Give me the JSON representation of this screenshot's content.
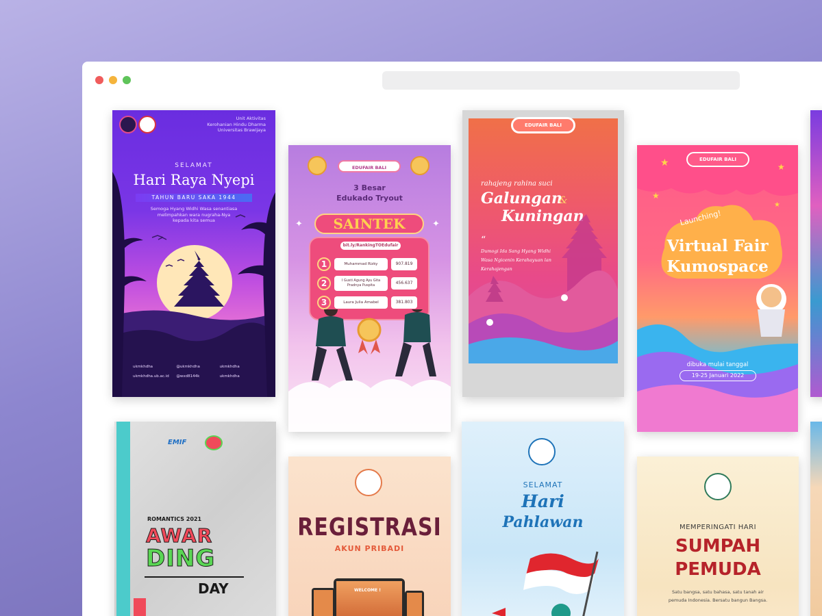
{
  "window": {
    "address_bar_value": ""
  },
  "cards": {
    "nyepi": {
      "org": [
        "Unit Aktivitas",
        "Kerohanian Hindu Dharma",
        "Universitas Brawijaya"
      ],
      "selamat": "SELAMAT",
      "title": "Hari Raya Nyepi",
      "ribbon": "TAHUN BARU SAKA 1944",
      "message": [
        "Semoga Hyang Widhi Wasa senantiasa",
        "melimpahkan wara nugraha-Nya",
        "kepada kita semua"
      ],
      "socials": [
        "ukmkhdha",
        "@ukmkhdha",
        "ukmkhdha",
        "ukmkhdha.ub.ac.id",
        "@wxd8144k",
        "ukmkhdha"
      ]
    },
    "saintek": {
      "badge": "EDUFAIR BALI",
      "subtitle_line1": "3 Besar",
      "subtitle_line2": "Edukado Tryout",
      "title": "SAINTEK",
      "link": "bit.ly/RankingTOEdufair",
      "rankings": [
        {
          "rank": "1",
          "name": "Muhammad Rizky",
          "score": "907.819"
        },
        {
          "rank": "2",
          "name": "I Gusti Agung Ayu Gita Pradnya Puspita",
          "score": "456.637"
        },
        {
          "rank": "3",
          "name": "Laura Julia Amabel",
          "score": "381.803"
        }
      ]
    },
    "galungan": {
      "badge": "EDUFAIR BALI",
      "greeting": "rahajeng rahina suci",
      "title_line1": "Galungan",
      "title_amp": "&",
      "title_line2": "Kuningan",
      "quote_mark": "“",
      "quote": [
        "Dumogi Ida Sang Hyang Widhi",
        "Wasa Ngicenin Kerahayuan lan",
        "Kerahajengan"
      ]
    },
    "kumospace": {
      "badge": "EDUFAIR BALI",
      "launching": "Launching!",
      "title_line1": "Virtual Fair",
      "title_line2": "Kumospace",
      "open_text": "dibuka mulai tanggal",
      "dates": "19-25 Januari 2022"
    },
    "awarding": {
      "logo": "EMIF",
      "year": "ROMANTICS 2021",
      "line1": "AWAR",
      "line2": "DING",
      "line3": "DAY"
    },
    "registrasi": {
      "title": "REGISTRASI",
      "subtitle": "AKUN PRIBADI",
      "welcome": "WELCOME !"
    },
    "pahlawan": {
      "selamat": "SELAMAT",
      "title_line1": "Hari",
      "title_line2": "Pahlawan"
    },
    "sumpah": {
      "pre": "MEMPERINGATI HARI",
      "title_line1": "SUMPAH",
      "title_line2": "PEMUDA",
      "body": [
        "Satu bangsa, satu bahasa, satu tanah air",
        "pemuda Indonesia. Bersatu bangun Bangsa."
      ]
    }
  },
  "colors": {
    "dot_close": "#f05c5c",
    "dot_minimize": "#f5b43c",
    "dot_maximize": "#5fc45a",
    "nyepi_top": "#6d2fe0",
    "saintek_accent": "#ee4c7c",
    "galungan_accent": "#f0547c",
    "kumospace_accent": "#ff5a8a",
    "awarding_green": "#5ad654",
    "awarding_red": "#f04a5a",
    "registrasi_maroon": "#6a1f3a",
    "pahlawan_blue": "#1e73b8",
    "sumpah_red": "#b6232a"
  }
}
